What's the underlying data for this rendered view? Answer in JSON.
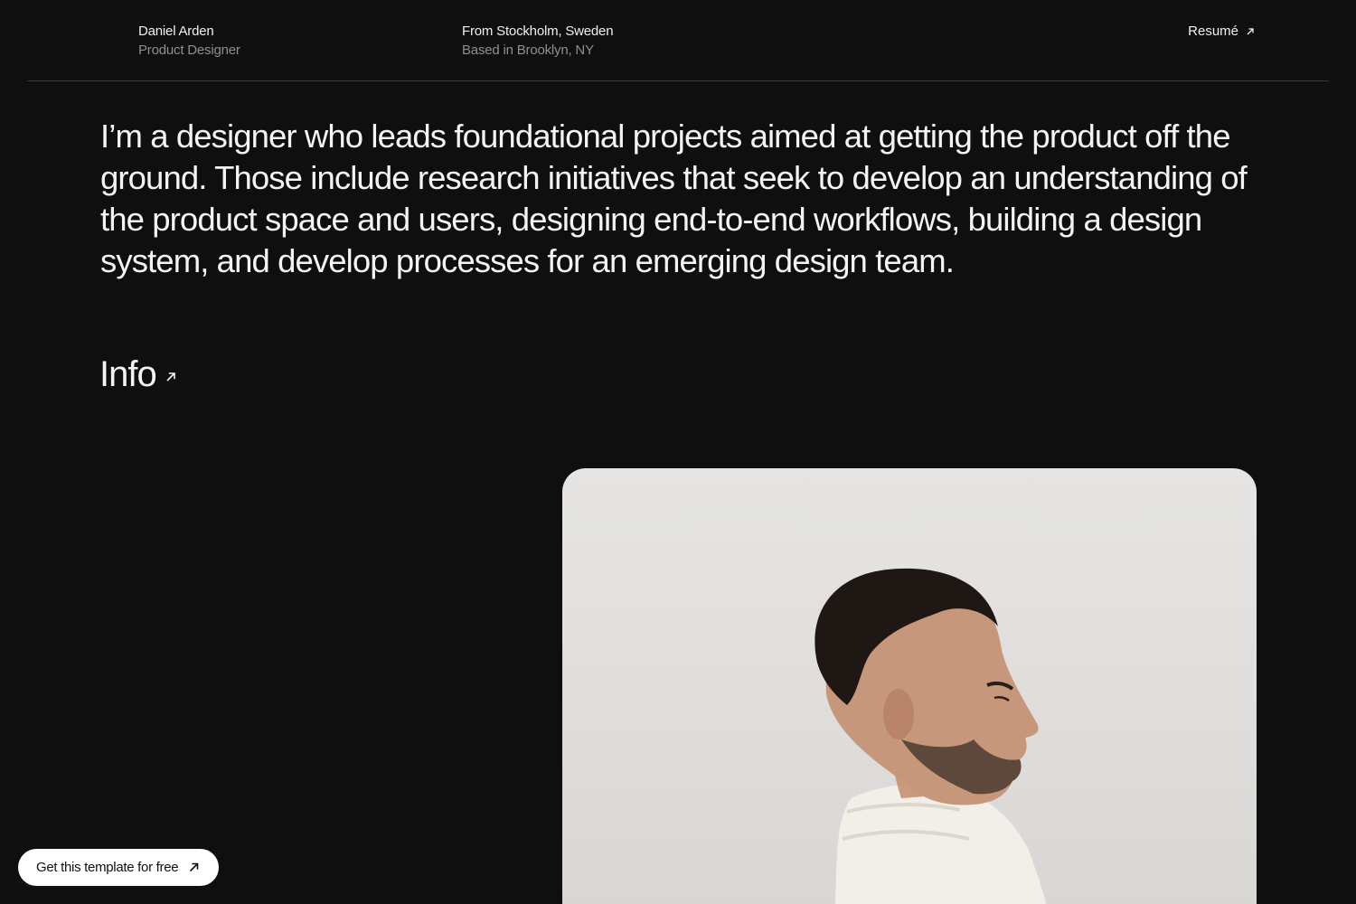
{
  "header": {
    "name": "Daniel Arden",
    "role": "Product Designer",
    "origin": "From Stockholm, Sweden",
    "location": "Based in Brooklyn, NY",
    "resume_label": "Resumé",
    "resume_icon": "arrow-up-right-icon"
  },
  "intro": {
    "text": "I’m a designer who leads foundational projects aimed at getting the product off the ground. Those include research initiatives that seek to develop an understanding of the product space and users, designing end-to-end workflows, building a design system, and develop processes for an emerging design team."
  },
  "info": {
    "label": "Info",
    "icon": "arrow-up-right-icon"
  },
  "cta": {
    "label": "Get this template for free",
    "icon": "arrow-up-right-icon"
  },
  "colors": {
    "background": "#0f0f0f",
    "text": "#f2f2f2",
    "muted": "#8f8f8f",
    "divider": "#3a3a3a",
    "cta_bg": "#ffffff"
  }
}
